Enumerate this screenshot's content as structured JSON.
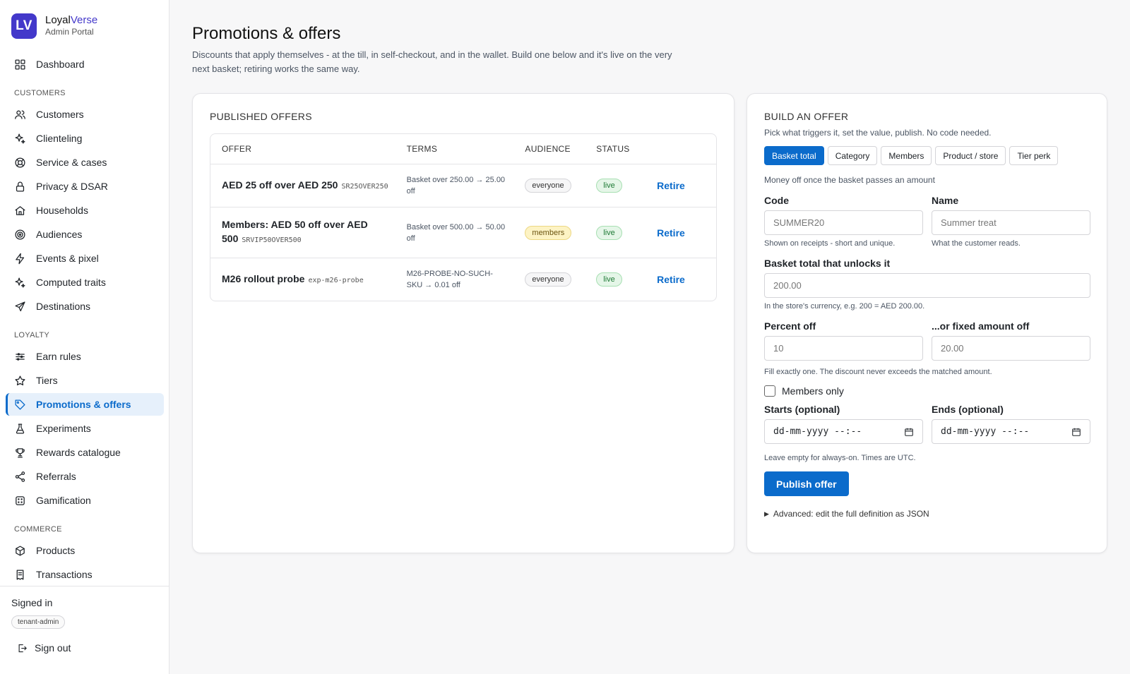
{
  "brand": {
    "logo": "LV",
    "name_a": "Loyal",
    "name_b": "Verse",
    "subtitle": "Admin Portal"
  },
  "nav": {
    "dashboard": "Dashboard",
    "section_customers": "CUSTOMERS",
    "customers": "Customers",
    "clienteling": "Clienteling",
    "service": "Service & cases",
    "privacy": "Privacy & DSAR",
    "households": "Households",
    "audiences": "Audiences",
    "events": "Events & pixel",
    "computed": "Computed traits",
    "destinations": "Destinations",
    "section_loyalty": "LOYALTY",
    "earn": "Earn rules",
    "tiers": "Tiers",
    "promotions": "Promotions & offers",
    "experiments": "Experiments",
    "rewards": "Rewards catalogue",
    "referrals": "Referrals",
    "gamification": "Gamification",
    "section_commerce": "COMMERCE",
    "products": "Products",
    "transactions": "Transactions"
  },
  "footer": {
    "signed_in": "Signed in",
    "user": "tenant-admin",
    "sign_out": "Sign out"
  },
  "page": {
    "title": "Promotions & offers",
    "description": "Discounts that apply themselves - at the till, in self-checkout, and in the wallet. Build one below and it's live on the very next basket; retiring works the same way."
  },
  "published": {
    "heading": "PUBLISHED OFFERS",
    "columns": {
      "offer": "OFFER",
      "terms": "TERMS",
      "audience": "AUDIENCE",
      "status": "STATUS"
    },
    "rows": [
      {
        "name": "AED 25 off over AED 250",
        "code": "SR25OVER250",
        "terms": "Basket over 250.00 → 25.00 off",
        "audience": "everyone",
        "status": "live",
        "action": "Retire"
      },
      {
        "name": "Members: AED 50 off over AED 500",
        "code": "SRVIP50OVER500",
        "terms": "Basket over 500.00 → 50.00 off",
        "audience": "members",
        "status": "live",
        "action": "Retire"
      },
      {
        "name": "M26 rollout probe",
        "code": "exp-m26-probe",
        "terms": "M26-PROBE-NO-SUCH-SKU → 0.01 off",
        "audience": "everyone",
        "status": "live",
        "action": "Retire"
      }
    ]
  },
  "builder": {
    "heading": "BUILD AN OFFER",
    "subtitle": "Pick what triggers it, set the value, publish. No code needed.",
    "tabs": [
      "Basket total",
      "Category",
      "Members",
      "Product / store",
      "Tier perk"
    ],
    "active_tab": "Basket total",
    "tab_description": "Money off once the basket passes an amount",
    "code_label": "Code",
    "code_placeholder": "SUMMER20",
    "code_hint": "Shown on receipts - short and unique.",
    "name_label": "Name",
    "name_placeholder": "Summer treat",
    "name_hint": "What the customer reads.",
    "threshold_label": "Basket total that unlocks it",
    "threshold_placeholder": "200.00",
    "threshold_hint": "In the store's currency, e.g. 200 = AED 200.00.",
    "percent_label": "Percent off",
    "percent_placeholder": "10",
    "fixed_label": "...or fixed amount off",
    "fixed_placeholder": "20.00",
    "amount_hint": "Fill exactly one. The discount never exceeds the matched amount.",
    "members_only": "Members only",
    "starts_label": "Starts (optional)",
    "starts_value": "dd-mm-yyyy --:--",
    "ends_label": "Ends (optional)",
    "ends_value": "dd-mm-yyyy --:--",
    "dates_hint": "Leave empty for always-on. Times are UTC.",
    "publish": "Publish offer",
    "advanced": "Advanced: edit the full definition as JSON"
  },
  "colors": {
    "accent": "#0b6bcb",
    "brand": "#4338ca",
    "live": "#1e7a35",
    "members": "#fdf3c4"
  }
}
